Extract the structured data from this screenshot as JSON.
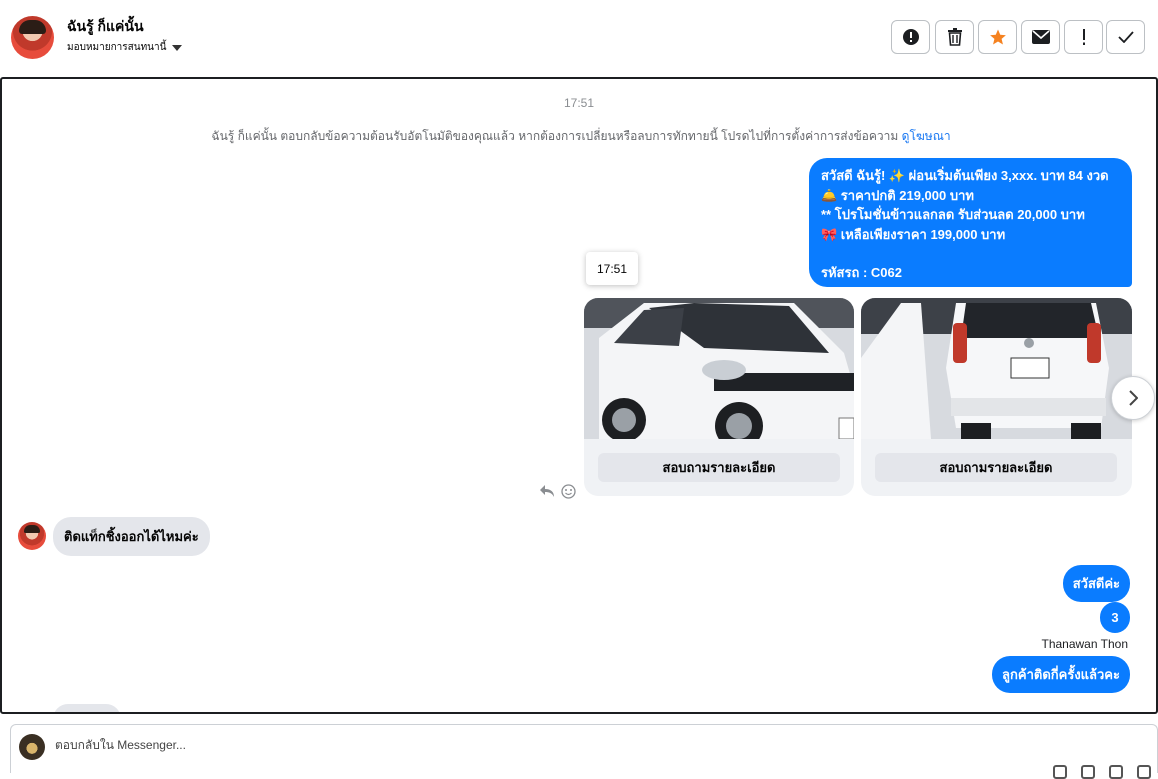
{
  "header": {
    "name": "ฉันรู้ ก็แค่นั้น",
    "assign_label": "มอบหมายการสนทนานี้"
  },
  "thread": {
    "timestamp": "17:51",
    "notice_text": "ฉันรู้ ก็แค่นั้น ตอบกลับข้อความต้อนรับอัตโนมัติของคุณแล้ว หากต้องการเปลี่ยนหรือลบการทักทายนี้ โปรดไปที่การตั้งค่าการส่งข้อความ",
    "notice_link": "ดูโฆษณา",
    "promo_lines": [
      "สวัสดี ฉันรู้! ✨  ผ่อนเริ่มต้นเพียง 3,xxx. บาท 84 งวด",
      "🛎️ ราคาปกติ 219,000 บาท",
      "** โปรโมชั่นข้าวแลกลด รับส่วนลด 20,000 บาท",
      "🎀  เหลือเพียงราคา 199,000 บาท",
      "",
      "รหัสรถ : C062"
    ],
    "hover_time": "17:51",
    "cards": [
      {
        "button_label": "สอบถามรายละเอียด"
      },
      {
        "button_label": "สอบถามรายละเอียด"
      }
    ],
    "customer_message": "ติดแท็กชิ้งออกได้ไหมค่ะ",
    "reply_1": "สวัสดีค่ะ",
    "reply_2": "3",
    "sender_name": "Thanawan Thon",
    "reply_3": "ลูกค้าติดกี่ครั้งแล้วคะ"
  },
  "composer": {
    "placeholder": "ตอบกลับใน Messenger..."
  },
  "colors": {
    "outgoing_bubble": "#0a7cff",
    "incoming_bubble": "#e4e6eb",
    "star_accent": "#f7b928"
  },
  "icons": [
    "alert-icon",
    "trash-icon",
    "star-icon",
    "envelope-icon",
    "exclamation-icon",
    "check-icon",
    "chevron-right-icon",
    "reply-icon",
    "emoji-icon"
  ]
}
